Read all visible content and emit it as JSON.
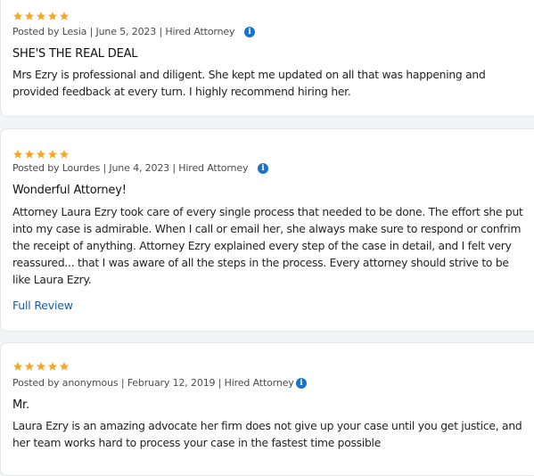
{
  "colors": {
    "star": "#f5a623",
    "info": "#1a73c8",
    "link": "#1a5ea8"
  },
  "icons": {
    "rating": "star-icon",
    "info": "info-icon"
  },
  "reviews": [
    {
      "rating": 5,
      "meta": "Posted by Lesia | June 5, 2023 | Hired Attorney",
      "title": "SHE'S THE REAL DEAL",
      "body": "Mrs Ezry is professional and diligent. She kept me updated on all that was happening and provided feedback at every turn. I highly recommend hiring her."
    },
    {
      "rating": 5,
      "meta": "Posted by Lourdes | June 4, 2023 | Hired Attorney",
      "title": "Wonderful Attorney!",
      "body": "Attorney Laura Ezry took care of every single process that needed to be done. The effort she put into my case is admirable. When I call or email her, she always make sure to respond or confrim the receipt of anything. Attorney Ezry explained every step of the case in detail, and I felt very reassured... that I was aware of all the steps in the process. Every attorney should strive to be like Laura Ezry.",
      "link": "Full Review"
    },
    {
      "rating": 5,
      "meta": "Posted by anonymous | February 12, 2019 | Hired Attorney",
      "title": "Mr.",
      "body": "Laura Ezry is an amazing advocate her firm does not give up your case until you get justice, and her team works hard to process your case in the fastest time possible"
    }
  ]
}
